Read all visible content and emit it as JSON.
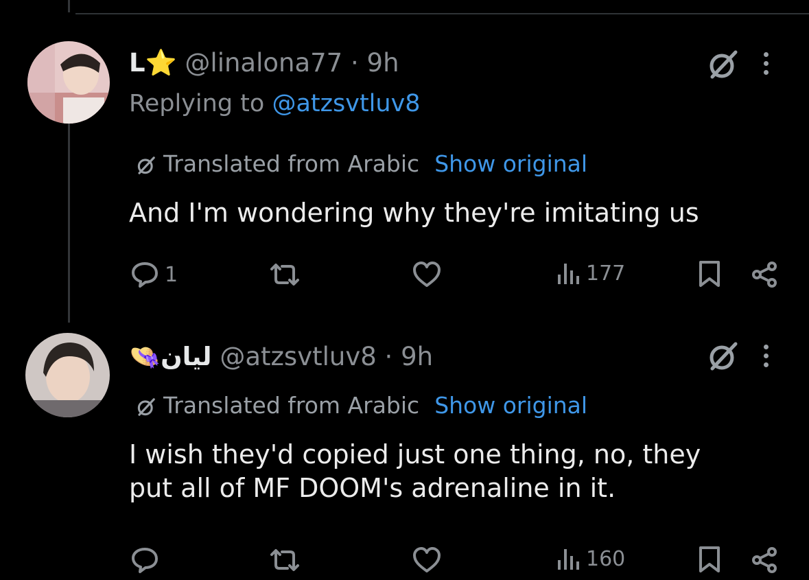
{
  "thread": {
    "tweets": [
      {
        "display_name": "L",
        "name_emoji": "⭐",
        "handle": "@linalona77",
        "separator": "·",
        "time": "9h",
        "replying_prefix": "Replying to",
        "replying_to": "@atzsvtluv8",
        "translated_label": "Translated from Arabic",
        "show_original": "Show original",
        "text": "And I'm wondering why they're imitating us",
        "replies": "1",
        "views": "177"
      },
      {
        "display_name": "ليان",
        "name_emoji": "👒",
        "handle": "@atzsvtluv8",
        "separator": "·",
        "time": "9h",
        "translated_label": "Translated from Arabic",
        "show_original": "Show original",
        "text": "I wish they'd copied just one thing, no, they\nput all of MF DOOM's adrenaline in it.",
        "views": "160"
      }
    ]
  },
  "colors": {
    "background": "#000000",
    "text": "#e7e9ea",
    "muted": "#8b8f94",
    "link": "#3f97e8",
    "divider": "#2f3336"
  },
  "icons": [
    "reply-icon",
    "retweet-icon",
    "like-icon",
    "views-icon",
    "bookmark-icon",
    "share-icon",
    "grok-icon",
    "more-icon",
    "translate-icon"
  ]
}
